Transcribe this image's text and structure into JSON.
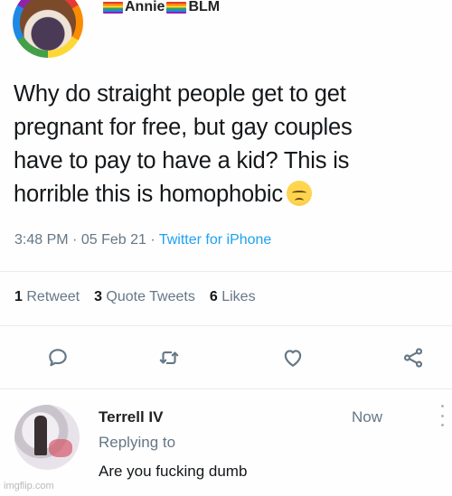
{
  "tweet": {
    "display_name_left_flag": "pride-flag",
    "display_name": "Annie",
    "display_name_right_flag": "pride-flag",
    "display_name_suffix": "BLM",
    "text_lines": [
      "Why do straight people get to get",
      "pregnant for free, but gay couples",
      "have to pay to have a kid? This is",
      "horrible this is homophobic"
    ],
    "text_emoji": "pensive-face-icon",
    "time": "3:48 PM",
    "separator": "·",
    "date": "05 Feb 21",
    "source": "Twitter for iPhone"
  },
  "stats": {
    "retweets_count": "1",
    "retweets_label": "Retweet",
    "quotes_count": "3",
    "quotes_label": "Quote Tweets",
    "likes_count": "6",
    "likes_label": "Likes"
  },
  "actions": {
    "reply_icon": "reply-icon",
    "retweet_icon": "retweet-icon",
    "like_icon": "heart-icon",
    "share_icon": "share-icon"
  },
  "reply": {
    "name": "Terrell IV",
    "time": "Now",
    "replying_to": "Replying to",
    "text": "Are you fucking dumb"
  },
  "watermark": "imgflip.com",
  "colors": {
    "text": "#14171a",
    "muted": "#657786",
    "link": "#1da1f2",
    "divider": "#e6ecf0"
  }
}
